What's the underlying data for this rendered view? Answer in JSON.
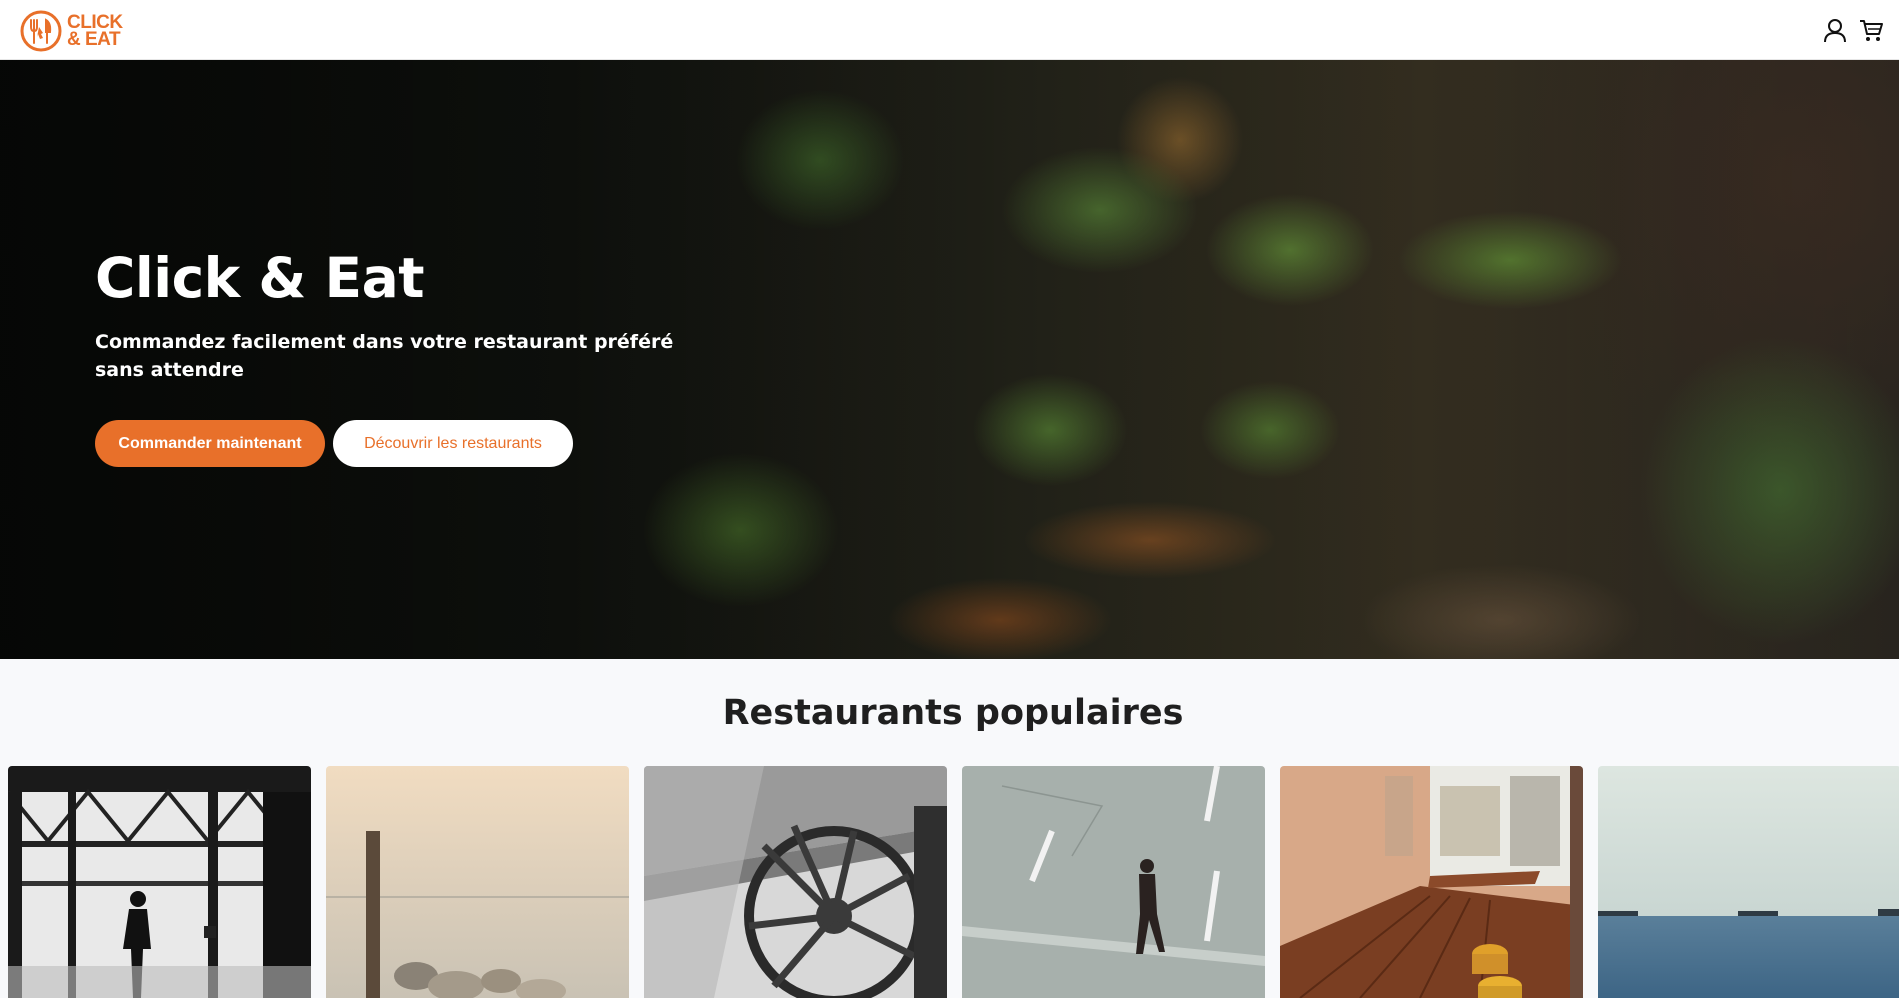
{
  "header": {
    "logo": {
      "line1": "CLICK",
      "line2": "& EAT"
    },
    "icons": [
      "user-icon",
      "cart-icon"
    ]
  },
  "hero": {
    "title": "Click & Eat",
    "subtitle": "Commandez facilement dans votre restaurant préféré sans attendre",
    "primary_button": "Commander maintenant",
    "secondary_button": "Découvrir les restaurants"
  },
  "popular": {
    "title": "Restaurants populaires",
    "cards": [
      {
        "image": "man-at-window-image"
      },
      {
        "image": "beach-post-image"
      },
      {
        "image": "wagon-wheel-image"
      },
      {
        "image": "man-walking-street-image"
      },
      {
        "image": "cafe-table-image"
      },
      {
        "image": "sea-ships-image"
      }
    ]
  },
  "colors": {
    "accent": "#e8702a",
    "header_bg": "#ffffff",
    "page_bg": "#f8f9fb",
    "title_text": "#1f1f1f"
  }
}
